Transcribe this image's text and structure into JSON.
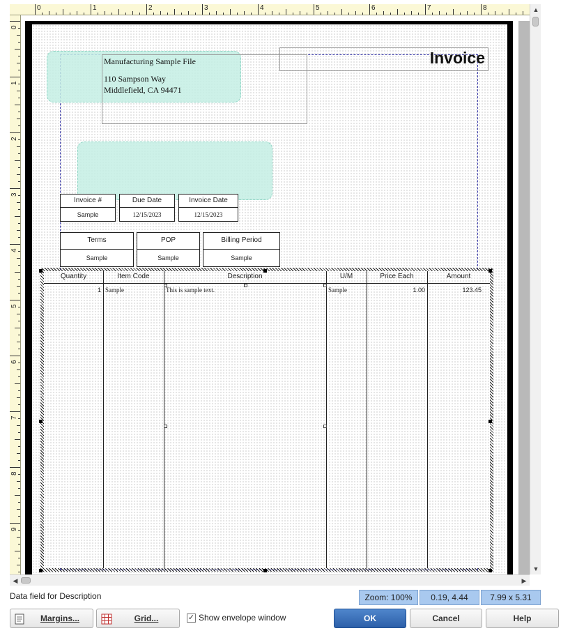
{
  "ruler": {
    "h_numbers": [
      "0",
      "1",
      "2",
      "3",
      "4",
      "5",
      "6",
      "7",
      "8"
    ],
    "v_numbers": [
      "0",
      "1",
      "2",
      "3",
      "4",
      "5",
      "6",
      "7",
      "8",
      "9"
    ]
  },
  "company": {
    "name": "Manufacturing Sample File",
    "address1": "110 Sampson Way",
    "address2": "Middlefield, CA  94471"
  },
  "form_title": "Invoice",
  "header_fields": [
    {
      "label": "Invoice #",
      "value": "Sample"
    },
    {
      "label": "Due Date",
      "value": "12/15/2023"
    },
    {
      "label": "Invoice Date",
      "value": "12/15/2023"
    }
  ],
  "header_fields2": [
    {
      "label": "Terms",
      "value": "Sample"
    },
    {
      "label": "POP",
      "value": "Sample"
    },
    {
      "label": "Billing Period",
      "value": "Sample"
    }
  ],
  "items_table": {
    "columns": [
      "Quantity",
      "Item Code",
      "Description",
      "U/M",
      "Price Each",
      "Amount"
    ],
    "row": {
      "quantity": "1",
      "item_code": "Sample",
      "description": "This is sample text.",
      "um": "Sample",
      "price_each": "1.00",
      "amount": "123.45"
    }
  },
  "status": {
    "text": "Data field for Description",
    "zoom": "Zoom: 100%",
    "position": "0.19, 4.44",
    "size": "7.99 x 5.31"
  },
  "buttons": {
    "margins": "Margins...",
    "grid": "Grid...",
    "envelope": "Show envelope window",
    "ok": "OK",
    "cancel": "Cancel",
    "help": "Help"
  },
  "envelope_checked": true,
  "icons": [
    "margins-icon",
    "grid-icon",
    "checkbox-checked-icon",
    "scroll-up-icon",
    "scroll-down-icon",
    "scroll-left-icon",
    "scroll-right-icon"
  ]
}
